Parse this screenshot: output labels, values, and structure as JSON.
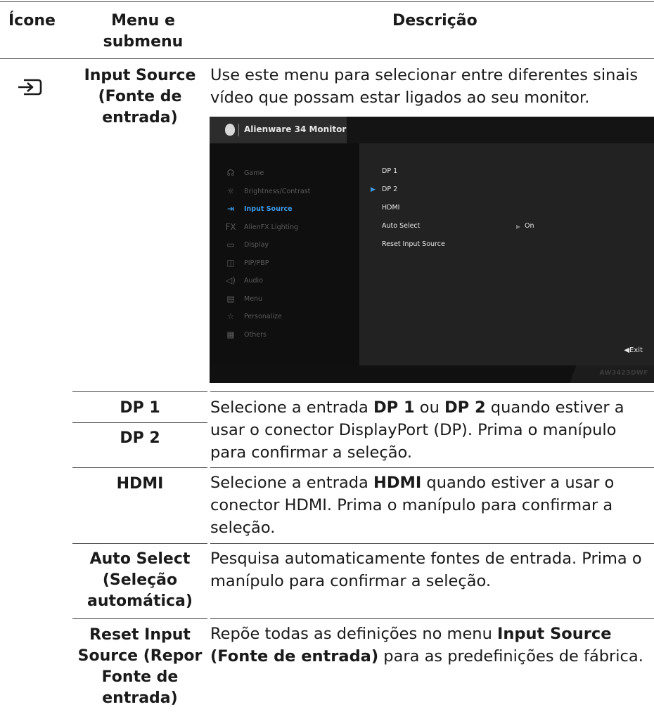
{
  "header": {
    "icon_col": "Ícone",
    "menu_col_line1": "Menu e",
    "menu_col_line2": "submenu",
    "desc_col": "Descrição"
  },
  "main_row": {
    "menu_name_line1": "Input Source",
    "menu_name_line2": "(Fonte de",
    "menu_name_line3": "entrada)",
    "icon": "input-source-icon",
    "description_line1": "Use este menu para selecionar entre diferentes sinais",
    "description_line2": "vídeo que possam estar ligados ao seu monitor."
  },
  "osd": {
    "title": "Alienware 34 Monitor",
    "menu_items": [
      {
        "label": "Game",
        "icon": "gamepad-icon",
        "glyph": "☊"
      },
      {
        "label": "Brightness/Contrast",
        "icon": "brightness-icon",
        "glyph": "☼"
      },
      {
        "label": "Input Source",
        "icon": "input-source-icon",
        "glyph": "⇥"
      },
      {
        "label": "AlienFX Lighting",
        "icon": "fx-icon",
        "glyph": "FX"
      },
      {
        "label": "Display",
        "icon": "display-icon",
        "glyph": "▭"
      },
      {
        "label": "PIP/PBP",
        "icon": "pip-icon",
        "glyph": "◫"
      },
      {
        "label": "Audio",
        "icon": "speaker-icon",
        "glyph": "◁)"
      },
      {
        "label": "Menu",
        "icon": "menu-icon",
        "glyph": "▤"
      },
      {
        "label": "Personalize",
        "icon": "star-icon",
        "glyph": "☆"
      },
      {
        "label": "Others",
        "icon": "others-icon",
        "glyph": "▦"
      }
    ],
    "active_item": "Input Source",
    "submenu": [
      "DP 1",
      "DP 2",
      "HDMI",
      "Auto Select",
      "Reset Input Source"
    ],
    "selected_submenu": "DP 2",
    "auto_select_value": "On",
    "exit_label": "◀Exit",
    "model": "AW3423DWF",
    "accent_color": "#3d9ae8"
  },
  "rows": [
    {
      "names": [
        "DP 1",
        "DP 2"
      ],
      "desc_parts": [
        "Selecione a entrada ",
        "DP 1",
        " ou ",
        "DP 2",
        " quando estiver a",
        "usar o conector DisplayPort (DP). Prima o manípulo",
        "para confirmar a seleção."
      ]
    },
    {
      "names": [
        "HDMI"
      ],
      "desc_parts": [
        "Selecione a entrada ",
        "HDMI",
        " quando estiver a usar o",
        "conector HDMI. Prima o manípulo para confirmar a",
        "seleção."
      ]
    },
    {
      "names": [
        "Auto Select",
        "(Seleção",
        "automática)"
      ],
      "desc_parts": [
        "Pesquisa automaticamente fontes de entrada. Prima o",
        "manípulo para confirmar a seleção."
      ]
    },
    {
      "names": [
        "Reset Input",
        "Source (Repor",
        "Fonte de",
        "entrada)"
      ],
      "desc_parts": [
        "Repõe todas as definições no menu ",
        "Input Source",
        "(Fonte de entrada)",
        " para as predefinições de fábrica."
      ]
    }
  ]
}
